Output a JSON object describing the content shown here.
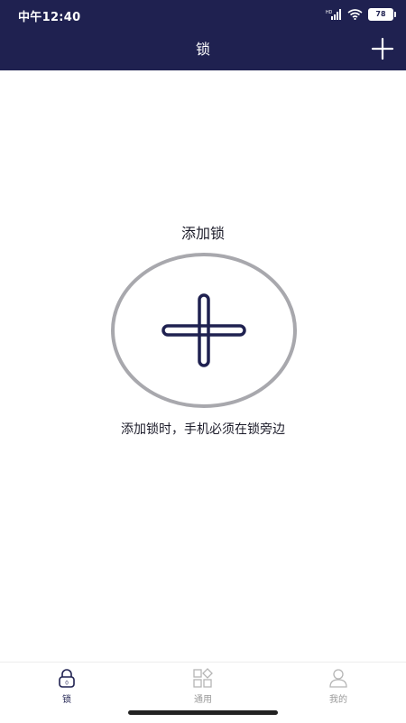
{
  "status_bar": {
    "time": "中午12:40",
    "battery": "78",
    "network_label": "HD"
  },
  "header": {
    "title": "锁",
    "add_icon": "plus-icon"
  },
  "main": {
    "add_lock_title": "添加锁",
    "hint": "添加锁时，手机必须在锁旁边",
    "circle_icon": "plus-icon"
  },
  "tabs": [
    {
      "label": "锁",
      "icon": "lock-icon",
      "active": true
    },
    {
      "label": "通用",
      "icon": "grid-icon",
      "active": false
    },
    {
      "label": "我的",
      "icon": "person-icon",
      "active": false
    }
  ],
  "colors": {
    "header_bg": "#1f2150",
    "accent": "#1f2150",
    "tab_inactive": "#9a9a9a",
    "circle_border": "#a8a8ad"
  }
}
